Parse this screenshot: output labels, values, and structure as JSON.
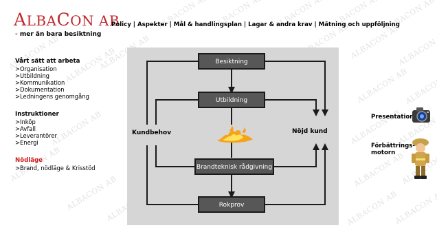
{
  "logo": {
    "first": "A",
    "rest": "LBA",
    "second": "C",
    "tail": "ON AB"
  },
  "tagline": {
    "dash": "-",
    "text": " mer än bara besiktning"
  },
  "watermark": "ALBACON AB",
  "nav": {
    "items": [
      "Policy",
      "Aspekter",
      "Mål & handlingsplan",
      "Lagar & andra krav",
      "Mätning och uppföljning"
    ],
    "separator": "|"
  },
  "sidebar": {
    "section1": {
      "title": "Vårt sätt att arbeta",
      "items": [
        ">Organisation",
        ">Utbildning",
        ">Kommunikation",
        ">Dokumentation",
        ">Ledningens genomgång"
      ]
    },
    "section2": {
      "title": "Instruktioner",
      "items": [
        ">Inköp",
        ">Avfall",
        ">Leverantörer",
        ">Energi"
      ]
    },
    "section3": {
      "title": "Nödläge",
      "items": [
        ">Brand, nödläge & Krisstöd"
      ]
    }
  },
  "diagram": {
    "boxes": [
      "Besiktning",
      "Utbildning",
      "Brandteknisk rådgivning",
      "Rokprov"
    ],
    "left_label": "Kundbehov",
    "right_label": "Nöjd kund"
  },
  "right_links": {
    "presentation": "Presentation",
    "improvement_line1": "Förbättrings-",
    "improvement_line2": "motorn"
  },
  "colors": {
    "brand_red": "#c1272d",
    "box_fill": "#575757",
    "panel": "#d6d6d6"
  },
  "icons": [
    "camera-icon",
    "firefighter-icon",
    "flame-icon"
  ]
}
